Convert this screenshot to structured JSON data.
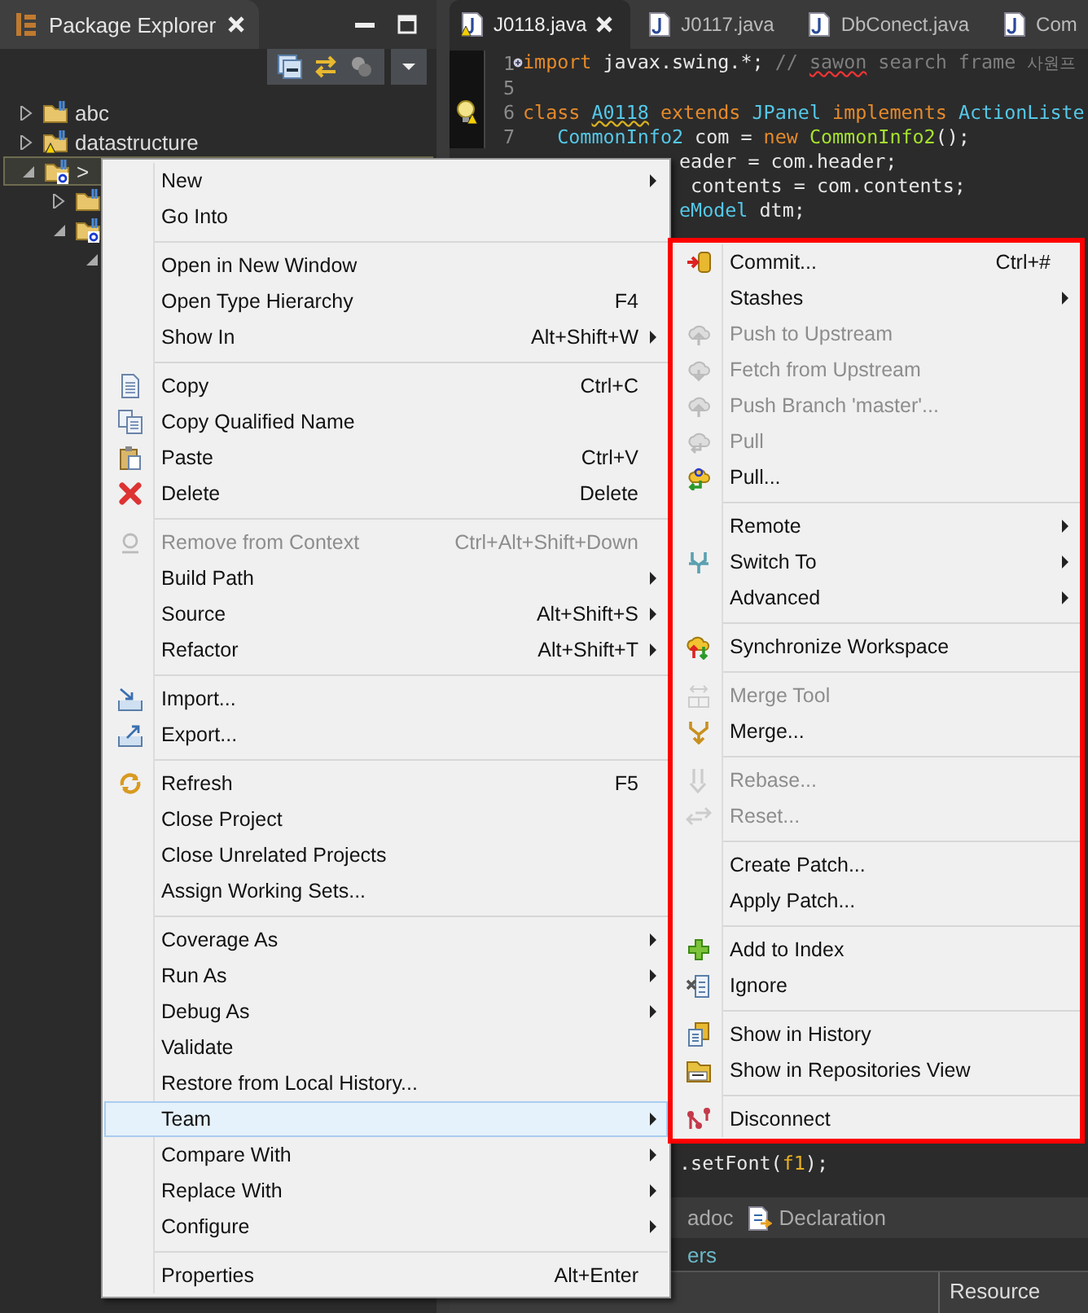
{
  "package_explorer": {
    "title": "Package Explorer",
    "tree": [
      {
        "label": "abc",
        "expanded": false,
        "selected": false,
        "warning": false
      },
      {
        "label": "datastructure",
        "expanded": false,
        "selected": false,
        "warning": true
      },
      {
        "label": ">",
        "expanded": true,
        "selected": true,
        "warning": false,
        "children": [
          {
            "expanded": false,
            "selected": false,
            "warning": false
          },
          {
            "expanded": true,
            "selected": false,
            "warning": false,
            "children": [
              {
                "expanded": true,
                "selected": false
              }
            ]
          }
        ]
      }
    ]
  },
  "editor": {
    "tabs": [
      {
        "label": "J0118.java",
        "selected": true,
        "warning": true
      },
      {
        "label": "J0117.java",
        "selected": false,
        "warning": false
      },
      {
        "label": "DbConect.java",
        "selected": false,
        "warning": false
      },
      {
        "label": "Com",
        "selected": false,
        "warning": false
      }
    ],
    "lines": [
      {
        "kind": "full",
        "number": "1",
        "folded": true,
        "warning": false,
        "tokens": [
          {
            "t": "import ",
            "kind": "keyword"
          },
          {
            "t": "javax.swing.*; ",
            "kind": "plain"
          },
          {
            "t": "// ",
            "kind": "comment"
          },
          {
            "t": "sawon",
            "kind": "spelling"
          },
          {
            "t": " search frame ",
            "kind": "comment"
          },
          {
            "t": "사원프",
            "kind": "hangul"
          }
        ]
      },
      {
        "kind": "full",
        "number": "5",
        "folded": false,
        "warning": false
      },
      {
        "kind": "full",
        "number": "6",
        "folded": false,
        "warning": true,
        "tokens": [
          {
            "t": "class ",
            "kind": "keyword"
          },
          {
            "t": "A0118",
            "kind": "warning"
          },
          {
            "t": " extends ",
            "kind": "keyword"
          },
          {
            "t": "JPanel ",
            "kind": "type"
          },
          {
            "t": "implements ",
            "kind": "keyword"
          },
          {
            "t": "ActionListe",
            "kind": "type"
          }
        ]
      },
      {
        "kind": "full",
        "number": "7",
        "folded": false,
        "warning": false,
        "tokens": [
          {
            "t": "   CommonInfo2",
            "kind": "type"
          },
          {
            "t": " com = ",
            "kind": "plain"
          },
          {
            "t": "new ",
            "kind": "keyword"
          },
          {
            "t": "CommonInfo2",
            "kind": "call"
          },
          {
            "t": "();",
            "kind": "plain"
          }
        ]
      },
      {
        "kind": "partial",
        "tokens": [
          {
            "t": "eader = com.header;",
            "kind": "plain"
          }
        ]
      },
      {
        "kind": "partial",
        "tokens": [
          {
            "t": " contents = com.contents;",
            "kind": "plain"
          }
        ]
      },
      {
        "kind": "partial",
        "tokens": [
          {
            "t": "eModel",
            "kind": "type"
          },
          {
            "t": " dtm;",
            "kind": "plain"
          }
        ]
      },
      {
        "kind": "bottom",
        "tokens": [
          {
            "t": ".setFont(",
            "kind": "plain"
          },
          {
            "t": "f1",
            "kind": "field"
          },
          {
            "t": ");",
            "kind": "plain"
          }
        ]
      }
    ],
    "bottom_panel": {
      "tabs": [
        {
          "label": "adoc",
          "selected": false,
          "icon": false
        },
        {
          "label": "Declaration",
          "selected": false,
          "icon": true
        }
      ],
      "view_title": "ers",
      "table": {
        "columns": [
          "Resource"
        ]
      }
    }
  },
  "context_menu": {
    "groups": [
      [
        {
          "label": "New",
          "submenu": true,
          "disabled": false,
          "selected": false
        },
        {
          "label": "Go Into",
          "submenu": false,
          "disabled": false,
          "selected": false
        }
      ],
      [
        {
          "label": "Open in New Window",
          "submenu": false,
          "disabled": false,
          "selected": false
        },
        {
          "label": "Open Type Hierarchy",
          "shortcut": "F4",
          "submenu": false,
          "disabled": false,
          "selected": false
        },
        {
          "label": "Show In",
          "shortcut": "Alt+Shift+W",
          "submenu": true,
          "disabled": false,
          "selected": false
        }
      ],
      [
        {
          "label": "Copy",
          "shortcut": "Ctrl+C",
          "submenu": false,
          "disabled": false,
          "selected": false
        },
        {
          "label": "Copy Qualified Name",
          "submenu": false,
          "disabled": false,
          "selected": false
        },
        {
          "label": "Paste",
          "shortcut": "Ctrl+V",
          "submenu": false,
          "disabled": false,
          "selected": false
        },
        {
          "label": "Delete",
          "shortcut": "Delete",
          "submenu": false,
          "disabled": false,
          "selected": false
        }
      ],
      [
        {
          "label": "Remove from Context",
          "shortcut": "Ctrl+Alt+Shift+Down",
          "submenu": false,
          "disabled": true,
          "selected": false
        },
        {
          "label": "Build Path",
          "submenu": true,
          "disabled": false,
          "selected": false
        },
        {
          "label": "Source",
          "shortcut": "Alt+Shift+S",
          "submenu": true,
          "disabled": false,
          "selected": false
        },
        {
          "label": "Refactor",
          "shortcut": "Alt+Shift+T",
          "submenu": true,
          "disabled": false,
          "selected": false
        }
      ],
      [
        {
          "label": "Import...",
          "submenu": false,
          "disabled": false,
          "selected": false
        },
        {
          "label": "Export...",
          "submenu": false,
          "disabled": false,
          "selected": false
        }
      ],
      [
        {
          "label": "Refresh",
          "shortcut": "F5",
          "submenu": false,
          "disabled": false,
          "selected": false
        },
        {
          "label": "Close Project",
          "submenu": false,
          "disabled": false,
          "selected": false
        },
        {
          "label": "Close Unrelated Projects",
          "submenu": false,
          "disabled": false,
          "selected": false
        },
        {
          "label": "Assign Working Sets...",
          "submenu": false,
          "disabled": false,
          "selected": false
        }
      ],
      [
        {
          "label": "Coverage As",
          "submenu": true,
          "disabled": false,
          "selected": false
        },
        {
          "label": "Run As",
          "submenu": true,
          "disabled": false,
          "selected": false
        },
        {
          "label": "Debug As",
          "submenu": true,
          "disabled": false,
          "selected": false
        },
        {
          "label": "Validate",
          "submenu": false,
          "disabled": false,
          "selected": false
        },
        {
          "label": "Restore from Local History...",
          "submenu": false,
          "disabled": false,
          "selected": false
        },
        {
          "label": "Team",
          "submenu": true,
          "disabled": false,
          "selected": true
        },
        {
          "label": "Compare With",
          "submenu": true,
          "disabled": false,
          "selected": false
        },
        {
          "label": "Replace With",
          "submenu": true,
          "disabled": false,
          "selected": false
        },
        {
          "label": "Configure",
          "submenu": true,
          "disabled": false,
          "selected": false
        }
      ],
      [
        {
          "label": "Properties",
          "shortcut": "Alt+Enter",
          "submenu": false,
          "disabled": false,
          "selected": false
        }
      ]
    ]
  },
  "team_submenu": {
    "highlighted": true,
    "groups": [
      [
        {
          "label": "Commit...",
          "shortcut": "Ctrl+#",
          "submenu": false,
          "disabled": false,
          "selected": false
        },
        {
          "label": "Stashes",
          "submenu": true,
          "disabled": false,
          "selected": false
        },
        {
          "label": "Push to Upstream",
          "submenu": false,
          "disabled": true,
          "selected": false
        },
        {
          "label": "Fetch from Upstream",
          "submenu": false,
          "disabled": true,
          "selected": false
        },
        {
          "label": "Push Branch 'master'...",
          "submenu": false,
          "disabled": true,
          "selected": false
        },
        {
          "label": "Pull",
          "submenu": false,
          "disabled": true,
          "selected": false
        },
        {
          "label": "Pull...",
          "submenu": false,
          "disabled": false,
          "selected": false
        }
      ],
      [
        {
          "label": "Remote",
          "submenu": true,
          "disabled": false,
          "selected": false
        },
        {
          "label": "Switch To",
          "submenu": true,
          "disabled": false,
          "selected": false
        },
        {
          "label": "Advanced",
          "submenu": true,
          "disabled": false,
          "selected": false
        }
      ],
      [
        {
          "label": "Synchronize Workspace",
          "submenu": false,
          "disabled": false,
          "selected": false
        }
      ],
      [
        {
          "label": "Merge Tool",
          "submenu": false,
          "disabled": true,
          "selected": false
        },
        {
          "label": "Merge...",
          "submenu": false,
          "disabled": false,
          "selected": false
        }
      ],
      [
        {
          "label": "Rebase...",
          "submenu": false,
          "disabled": true,
          "selected": false
        },
        {
          "label": "Reset...",
          "submenu": false,
          "disabled": true,
          "selected": false
        }
      ],
      [
        {
          "label": "Create Patch...",
          "submenu": false,
          "disabled": false,
          "selected": false
        },
        {
          "label": "Apply Patch...",
          "submenu": false,
          "disabled": false,
          "selected": false
        }
      ],
      [
        {
          "label": "Add to Index",
          "submenu": false,
          "disabled": false,
          "selected": false
        },
        {
          "label": "Ignore",
          "submenu": false,
          "disabled": false,
          "selected": false
        }
      ],
      [
        {
          "label": "Show in History",
          "submenu": false,
          "disabled": false,
          "selected": false
        },
        {
          "label": "Show in Repositories View",
          "submenu": false,
          "disabled": false,
          "selected": false
        }
      ],
      [
        {
          "label": "Disconnect",
          "submenu": false,
          "disabled": false,
          "selected": false
        }
      ]
    ]
  }
}
